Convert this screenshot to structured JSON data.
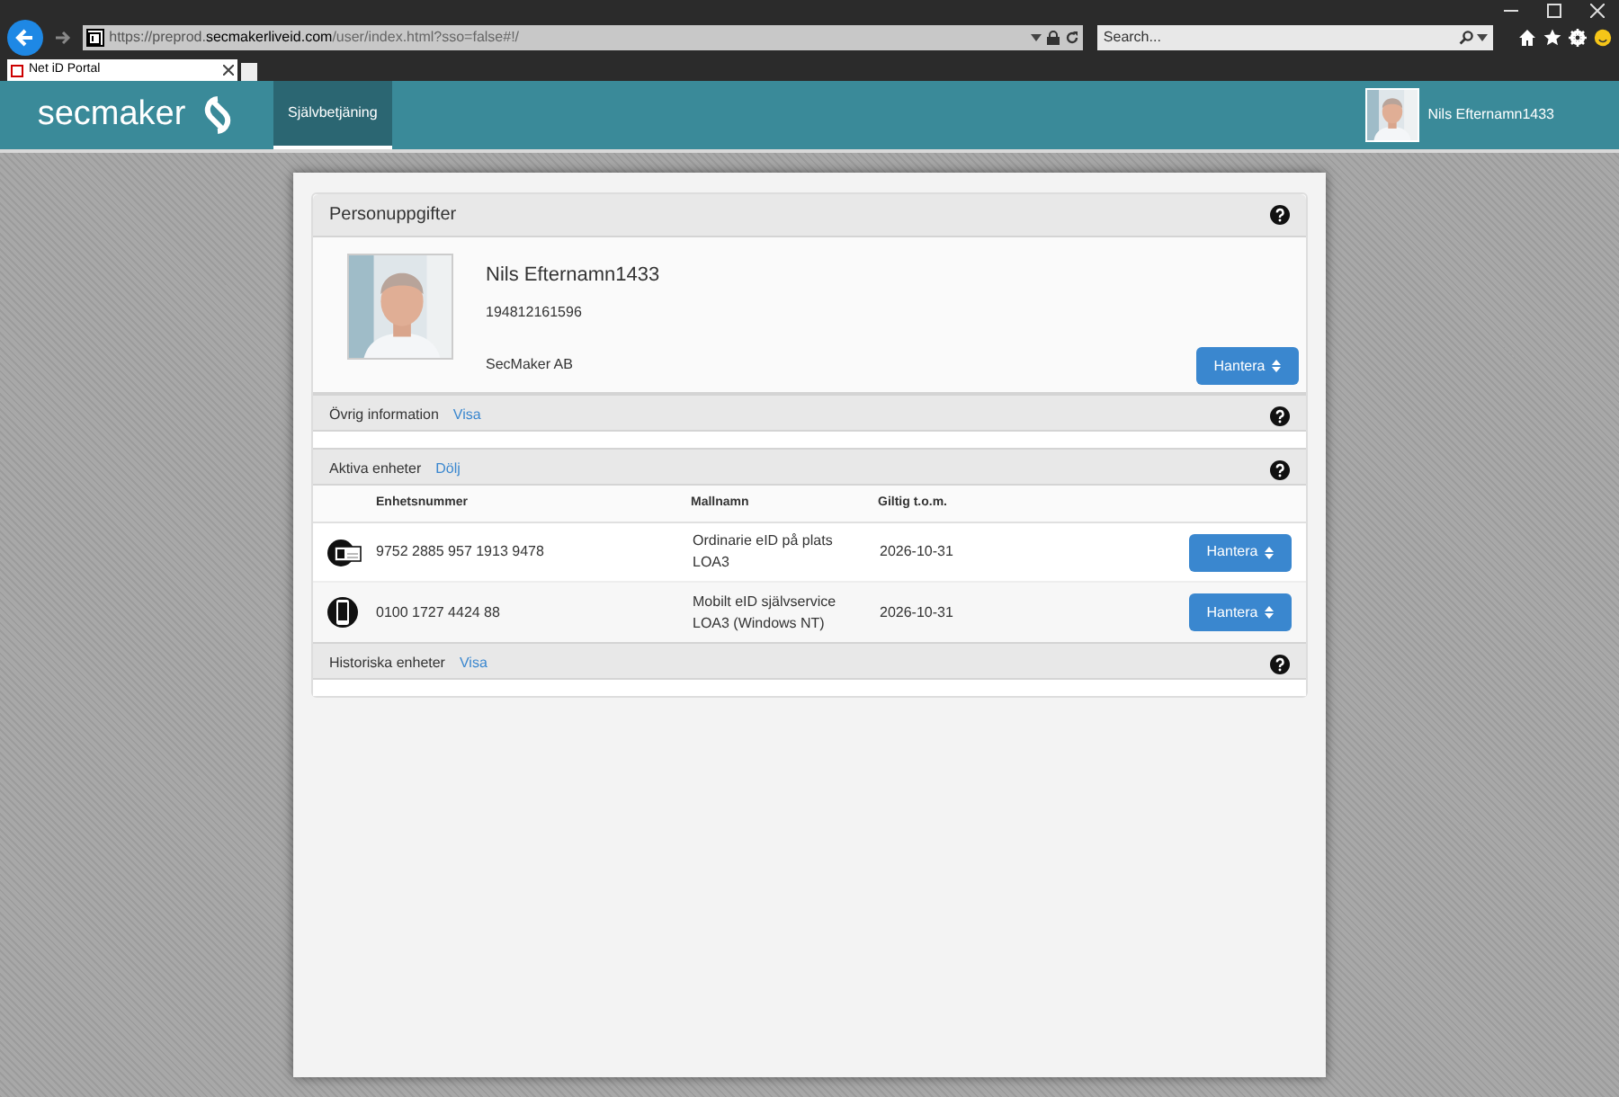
{
  "browser": {
    "url": {
      "scheme": "https://preprod.",
      "domain": "secmakerliveid.com",
      "path": "/user/index.html?sso=false#!/"
    },
    "search": {
      "placeholder": "Search..."
    },
    "tabs": [
      {
        "title": "Net iD Portal",
        "selected": true
      }
    ]
  },
  "header": {
    "logo": "secmaker",
    "nav": [
      {
        "label": "Självbetjäning",
        "selected": true
      }
    ],
    "user_name": "Nils Efternamn1433"
  },
  "person": {
    "title": "Personuppgifter",
    "name": "Nils Efternamn1433",
    "id_number": "194812161596",
    "organization": "SecMaker AB",
    "button": "Hantera"
  },
  "sections": [
    {
      "title": "Övrig information",
      "toggle": "Visa"
    },
    {
      "title": "Aktiva enheter",
      "toggle": "Dölj",
      "devices": {
        "columns": [
          "Enhetsnummer",
          "Mallnamn",
          "Giltig t.o.m."
        ],
        "rows": [
          {
            "kind": "card",
            "number": "9752 2885 957 1913 9478",
            "template": [
              "Ordinarie eID på plats",
              "LOA3"
            ],
            "valid_until": "2026-10-31",
            "button": "Hantera"
          },
          {
            "kind": "phone",
            "number": "0100 1727 4424 88",
            "template": [
              "Mobilt eID självservice",
              "LOA3 (Windows NT)"
            ],
            "valid_until": "2026-10-31",
            "button": "Hantera"
          }
        ]
      }
    },
    {
      "title": "Historiska enheter",
      "toggle": "Visa"
    }
  ]
}
